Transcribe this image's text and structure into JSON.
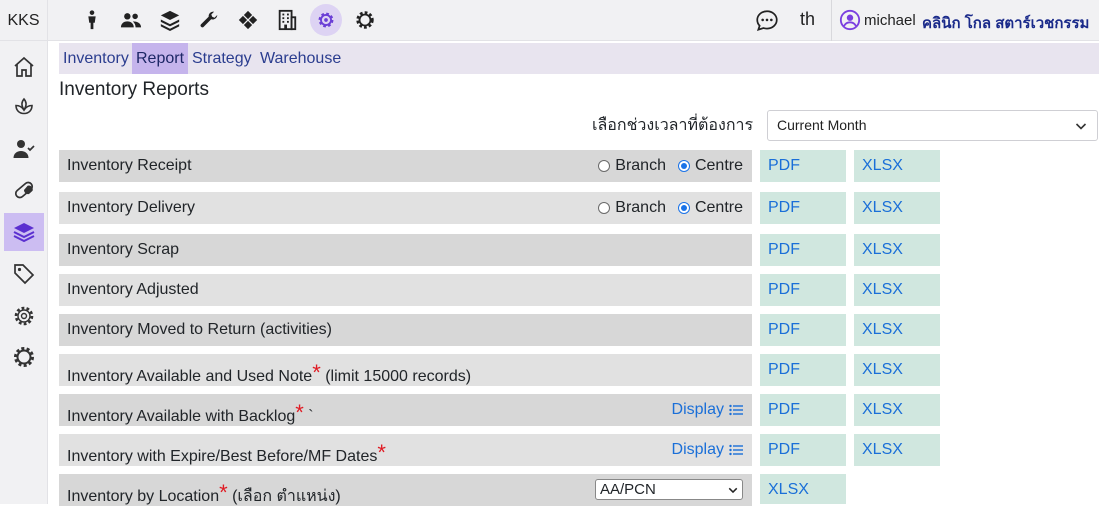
{
  "brand": "KKS",
  "topnav": {
    "icons": [
      "person-icon",
      "users-icon",
      "layers-icon",
      "wrench-icon",
      "diamond-icon",
      "building-icon",
      "gear-active-icon",
      "gear-icon"
    ],
    "language": "th",
    "username": "michael",
    "clinic": "คลินิก โกล สตาร์เวชกรรม"
  },
  "sidebar": {
    "icons": [
      "home-icon",
      "lotus-icon",
      "user-check-icon",
      "pill-icon",
      "layers-icon",
      "tag-icon",
      "settings-icon",
      "cog-icon"
    ],
    "active_index": 4
  },
  "tabs": [
    {
      "label": "Inventory",
      "active": false
    },
    {
      "label": "Report",
      "active": true
    },
    {
      "label": "Strategy",
      "active": false
    },
    {
      "label": "Warehouse",
      "active": false
    }
  ],
  "page_title": "Inventory Reports",
  "period": {
    "label": "เลือกช่วงเวลาที่ต้องการ",
    "value": "Current Month"
  },
  "reports": [
    {
      "label": "Inventory Receipt",
      "radios": {
        "branch": "Branch",
        "centre": "Centre",
        "selected": "centre"
      },
      "pdf": "PDF",
      "xlsx": "XLSX"
    },
    {
      "label": "Inventory Delivery",
      "radios": {
        "branch": "Branch",
        "centre": "Centre",
        "selected": "centre"
      },
      "pdf": "PDF",
      "xlsx": "XLSX"
    },
    {
      "label": "Inventory Scrap",
      "pdf": "PDF",
      "xlsx": "XLSX"
    },
    {
      "label": "Inventory Adjusted",
      "pdf": "PDF",
      "xlsx": "XLSX"
    },
    {
      "label": "Inventory Moved to Return (activities)",
      "pdf": "PDF",
      "xlsx": "XLSX"
    },
    {
      "label": "Inventory Available and Used Note",
      "star": "*",
      "suffix": " (limit 15000 records)",
      "pdf": "PDF",
      "xlsx": "XLSX"
    },
    {
      "label": "Inventory Available with Backlog",
      "star": "*",
      "suffix": " `",
      "display": "Display",
      "pdf": "PDF",
      "xlsx": "XLSX"
    },
    {
      "label": "Inventory with Expire/Best Before/MF Dates",
      "star": "*",
      "display": "Display",
      "pdf": "PDF",
      "xlsx": "XLSX"
    },
    {
      "label": "Inventory by Location",
      "star": "*",
      "suffix": " (เลือก ตำแหน่ง)",
      "location": "AA/PCN",
      "xlsx": "XLSX"
    }
  ],
  "colors": {
    "active_tab": "#c5b4ec",
    "active_sidebar": "#ccbdf2",
    "button_bg": "#d0e7df",
    "link": "#1a6fd8",
    "required_star": "#e01b24"
  }
}
